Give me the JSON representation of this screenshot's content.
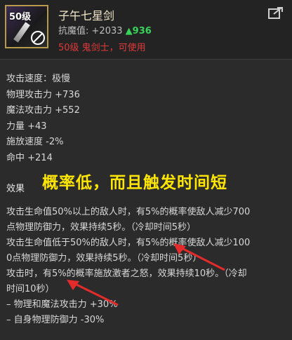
{
  "item": {
    "level_badge": "50级",
    "name": "子午七星剑",
    "stat_label": "抗魔值:",
    "stat_value": "+2033",
    "stat_delta": "▲936",
    "requirement": "50级 鬼剑士，可使用",
    "colors": {
      "name": "#f0e6c8",
      "requirement": "#e03a3a",
      "delta": "#38d35a",
      "callout": "#ffe600",
      "arrow": "#e32b2b"
    }
  },
  "attributes": [
    "攻击速度：极慢",
    "物理攻击力 +736",
    "魔法攻击力 +552",
    "力量 +43",
    "施放速度 -2%",
    "命中 +214"
  ],
  "annotation": "概率低，而且触发时间短",
  "effects": {
    "title": "效果",
    "lines": [
      "攻击生命值50%以上的敌人时，有5%的概率使敌人减少700",
      "点物理防御力，效果持续5秒。（冷却时间5秒）",
      "攻击生命值低于50%的敌人时，有5%的概率使敌人减少100",
      "0点物理防御力，效果持续5秒。（冷却时间5秒）",
      "攻击时，有5%的概率施放激者之怒，效果持续10秒。（冷却",
      "时间10秒）",
      " – 物理和魔法攻击力 +30%",
      " – 自身物理防御力 -30%"
    ]
  }
}
